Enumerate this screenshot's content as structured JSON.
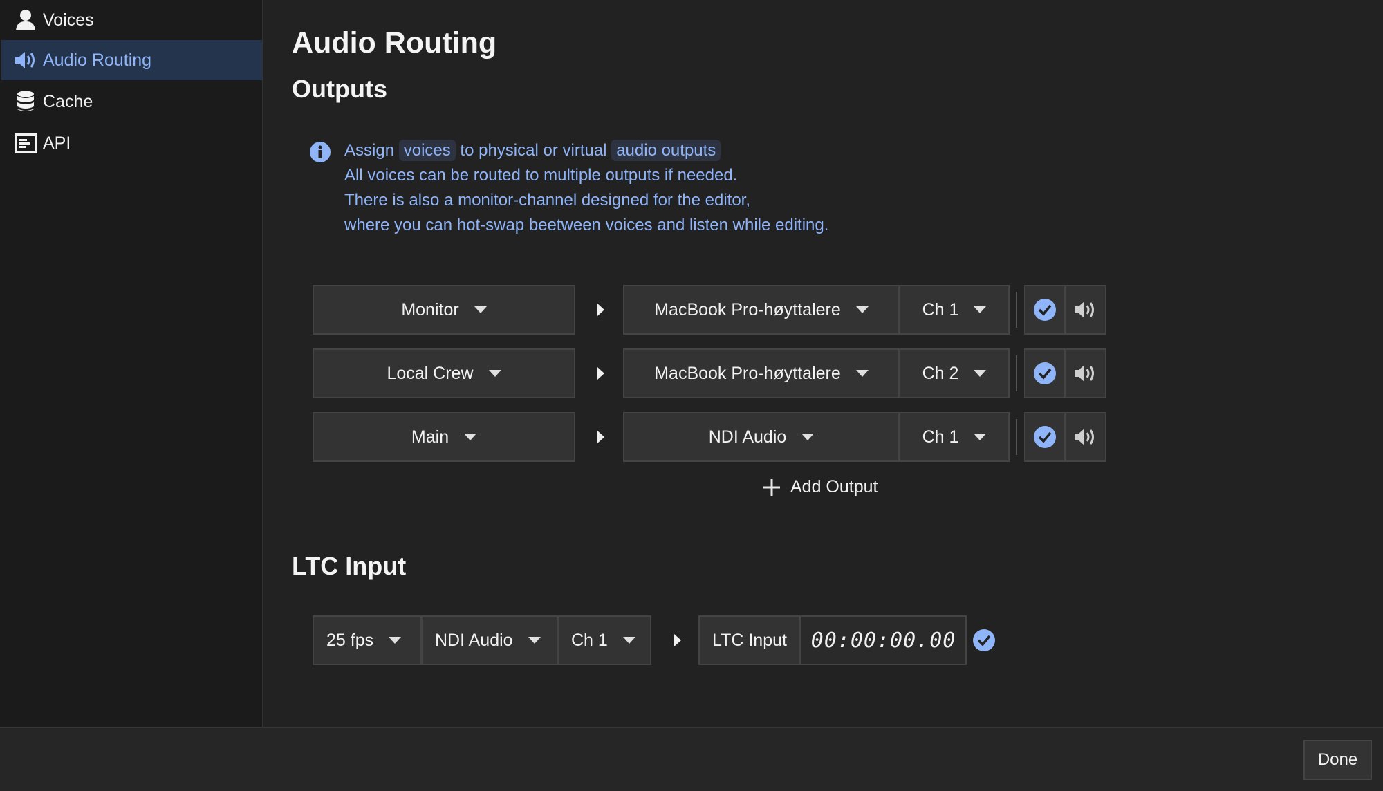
{
  "sidebar": {
    "items": [
      {
        "label": "Voices",
        "icon": "user-icon"
      },
      {
        "label": "Audio Routing",
        "icon": "speaker-icon",
        "active": true
      },
      {
        "label": "Cache",
        "icon": "database-icon"
      },
      {
        "label": "API",
        "icon": "api-icon"
      }
    ]
  },
  "main": {
    "title": "Audio Routing",
    "outputs_heading": "Outputs",
    "info": {
      "assign": "Assign",
      "voices_tag": "voices",
      "middle": "to physical or virtual",
      "outputs_tag": "audio outputs",
      "line2": "All voices can be routed to multiple outputs if needed.",
      "line3": "There is also a monitor-channel designed for the editor,",
      "line4": "where you can hot-swap beetween voices and listen while editing."
    },
    "routes": [
      {
        "voice": "Monitor",
        "device": "MacBook Pro-høyttalere",
        "channel": "Ch 1"
      },
      {
        "voice": "Local Crew",
        "device": "MacBook Pro-høyttalere",
        "channel": "Ch 2"
      },
      {
        "voice": "Main",
        "device": "NDI Audio",
        "channel": "Ch 1"
      }
    ],
    "add_output_label": "Add Output",
    "ltc_heading": "LTC Input",
    "ltc": {
      "fps": "25 fps",
      "device": "NDI Audio",
      "channel": "Ch 1",
      "label": "LTC Input",
      "timecode": "00:00:00.00"
    }
  },
  "footer": {
    "done_label": "Done"
  },
  "colors": {
    "accent": "#8fb4f8",
    "active_bg": "#25344d",
    "background": "#222222",
    "sidebar_bg": "#1b1b1b"
  }
}
